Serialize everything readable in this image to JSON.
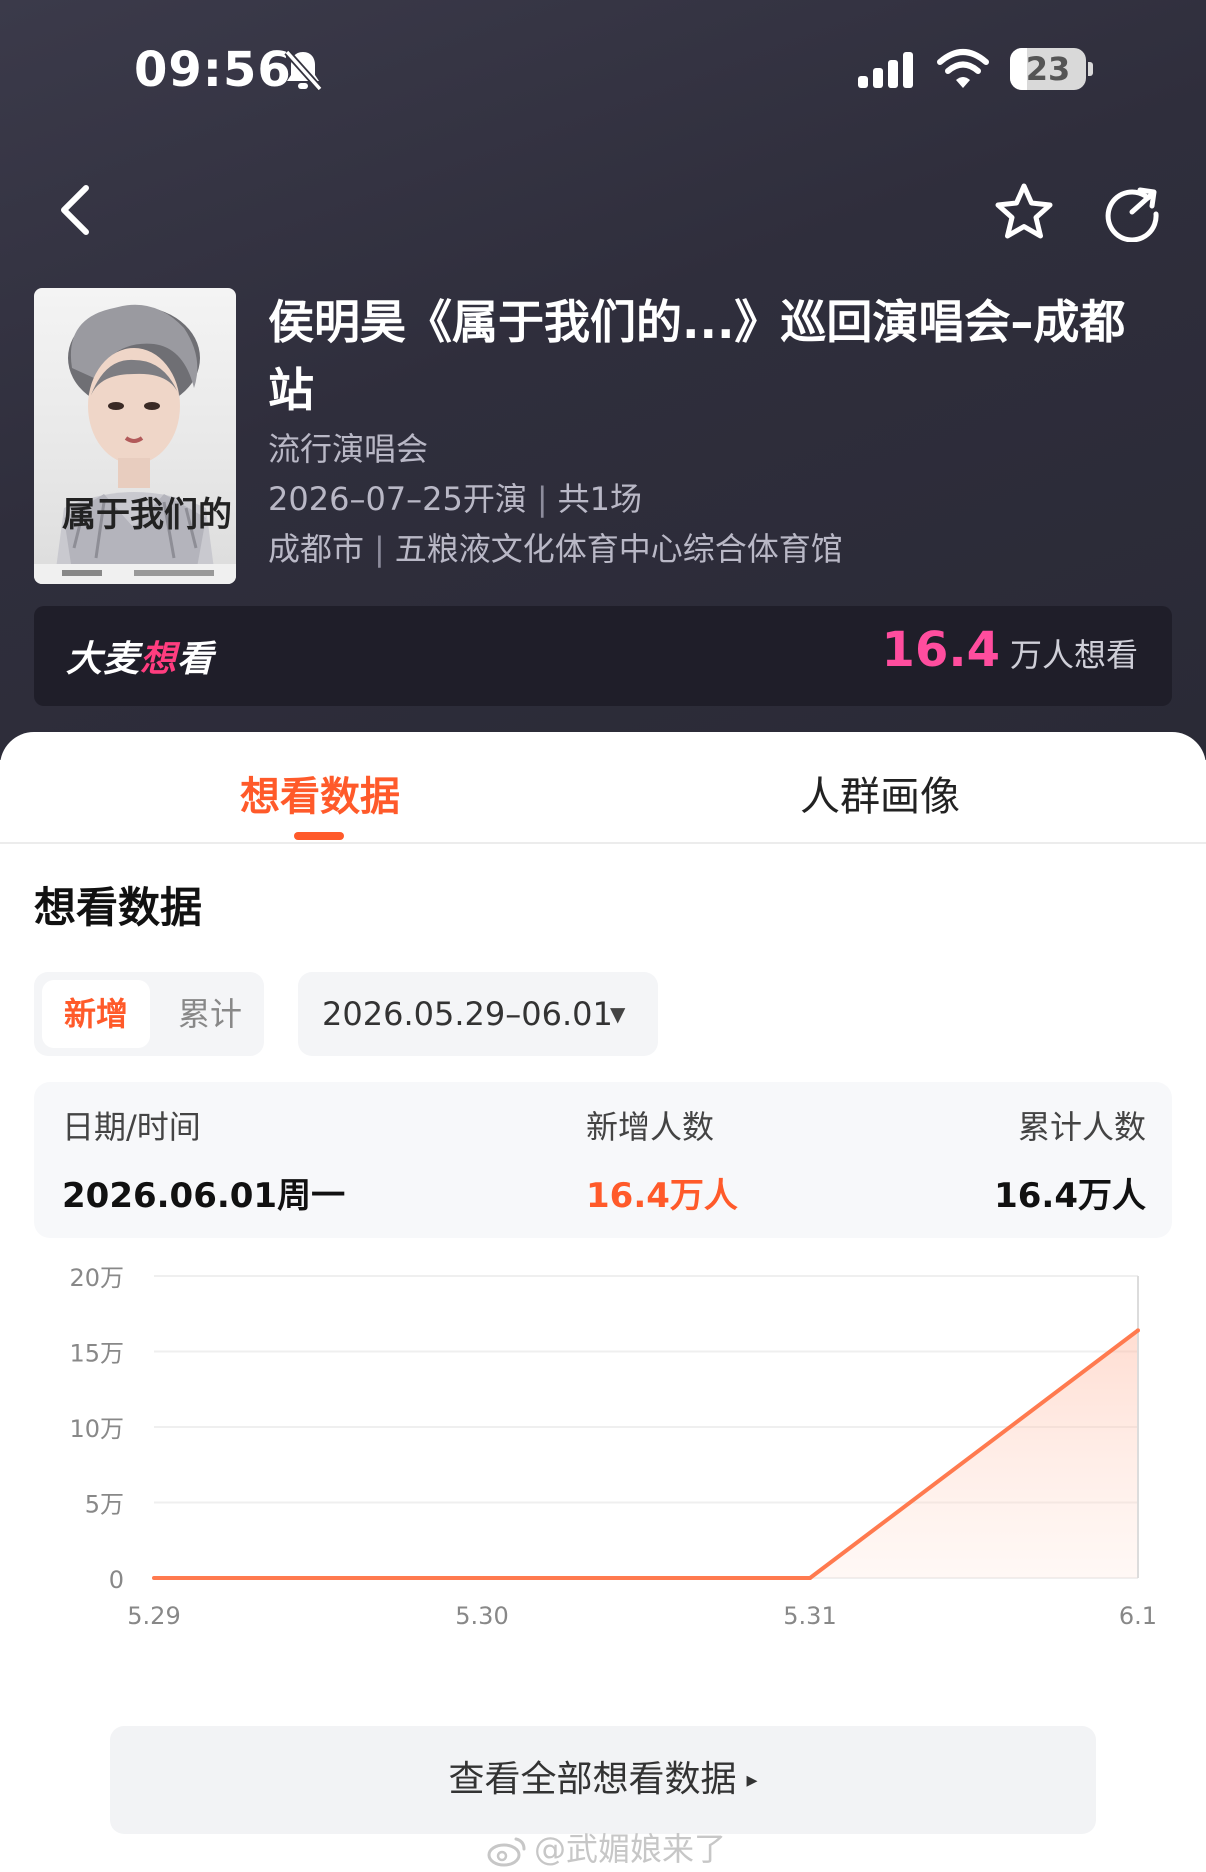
{
  "status_bar": {
    "time": "09:56",
    "battery": "23",
    "battery_level": 0.23
  },
  "icons": {
    "back": "chevron-left-icon",
    "favorite": "star-icon",
    "share": "share-icon",
    "bell": "bell-slash-icon"
  },
  "event": {
    "title": "侯明昊《属于我们的...》巡回演唱会–成都站",
    "category": "流行演唱会",
    "date_text": "2026–07–25开演",
    "sessions": "共1场",
    "city": "成都市",
    "venue": "五粮液文化体育中心综合体育馆",
    "poster_text": "属于我们的"
  },
  "want_bar": {
    "brand": "大麦想看",
    "count": "16.4",
    "unit": "万人想看"
  },
  "tabs": [
    "想看数据",
    "人群画像"
  ],
  "section_title": "想看数据",
  "filters": {
    "segment_active": "新增",
    "segment_other": "累计",
    "date_range": "2026.05.29–06.01",
    "caret": "▼"
  },
  "stats": {
    "date_label": "日期/时间",
    "new_label": "新增人数",
    "total_label": "累计人数",
    "date_value": "2026.06.01周一",
    "new_value": "16.4万人",
    "total_value": "16.4万人"
  },
  "chart_data": {
    "type": "area",
    "categories": [
      "5.29",
      "5.30",
      "5.31",
      "6.1"
    ],
    "values": [
      0,
      0,
      0,
      164000
    ],
    "y_ticks": [
      "0",
      "5万",
      "10万",
      "15万",
      "20万"
    ],
    "y_tick_values": [
      0,
      50000,
      100000,
      150000,
      200000
    ],
    "ylim": [
      0,
      200000
    ],
    "color": "#ff7a4f"
  },
  "buttons": {
    "view_all": "查看全部想看数据",
    "view_all_caret": "▸"
  },
  "watermark": "@武媚娘来了",
  "colors": {
    "accent": "#ff5a2a",
    "pink": "#ff4d9e",
    "hero_bg": "#2f2e3c"
  }
}
